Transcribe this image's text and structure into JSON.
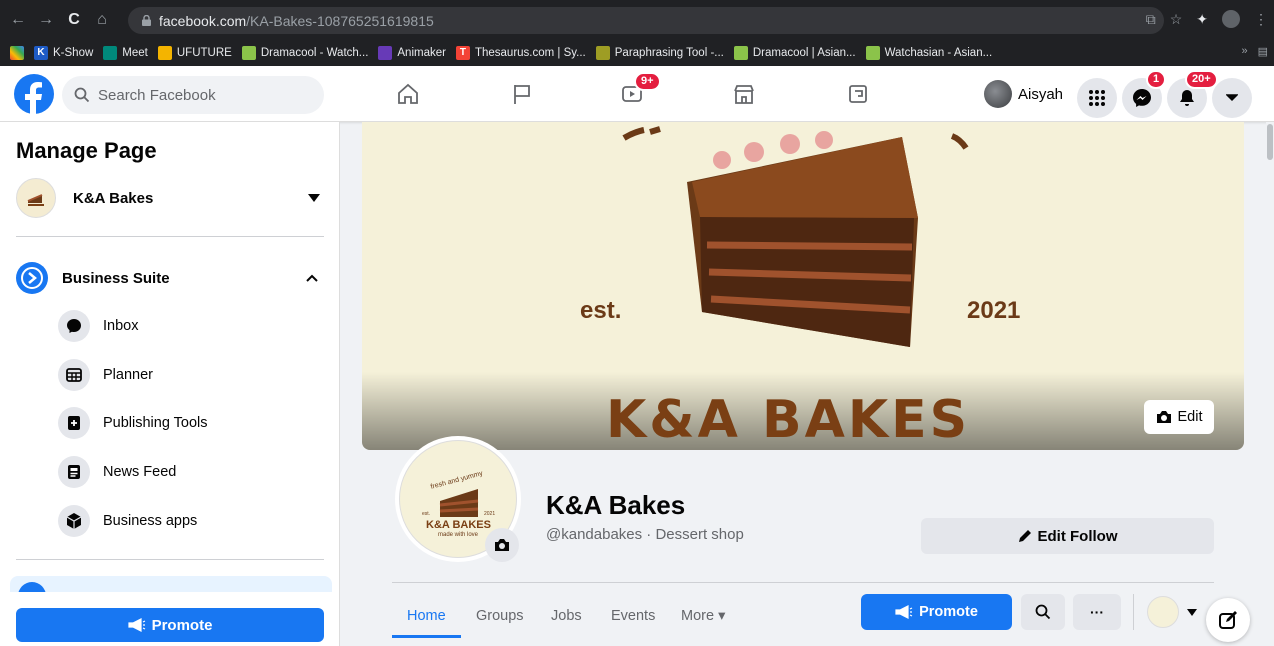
{
  "browser": {
    "url_domain": "facebook.com",
    "url_path": "/KA-Bakes-108765251619815",
    "bookmarks": [
      {
        "label": "K-Show",
        "icon": "k-show-icon",
        "color": "#3b5998"
      },
      {
        "label": "Meet",
        "icon": "meet-icon",
        "color": "#00897b"
      },
      {
        "label": "UFUTURE",
        "icon": "ufuture-icon",
        "color": "#f4b400"
      },
      {
        "label": "Dramacool - Watch...",
        "icon": "dramacool-icon",
        "color": "#8bc34a"
      },
      {
        "label": "Animaker",
        "icon": "animaker-icon",
        "color": "#673ab7"
      },
      {
        "label": "Thesaurus.com | Sy...",
        "icon": "thesaurus-icon",
        "color": "#f44336"
      },
      {
        "label": "Paraphrasing Tool -...",
        "icon": "paraphrasing-icon",
        "color": "#9e9d24"
      },
      {
        "label": "Dramacool | Asian...",
        "icon": "dramacool-icon",
        "color": "#8bc34a"
      },
      {
        "label": "Watchasian - Asian...",
        "icon": "watchasian-icon",
        "color": "#8bc34a"
      }
    ],
    "bookmarks_more": "»"
  },
  "topbar": {
    "search_placeholder": "Search Facebook",
    "watch_badge": "9+",
    "profile_name": "Aisyah",
    "messenger_badge": "1",
    "notifications_badge": "20+",
    "brand_color": "#1877f2"
  },
  "sidebar": {
    "title": "Manage Page",
    "page_name": "K&A Bakes",
    "business_suite_label": "Business Suite",
    "items": [
      {
        "label": "Inbox",
        "icon": "inbox-icon"
      },
      {
        "label": "Planner",
        "icon": "planner-icon"
      },
      {
        "label": "Publishing Tools",
        "icon": "publishing-tools-icon"
      },
      {
        "label": "News Feed",
        "icon": "news-feed-icon"
      },
      {
        "label": "Business apps",
        "icon": "business-apps-icon"
      }
    ],
    "promote_label": "Promote"
  },
  "cover": {
    "est_text": "est.",
    "year_text": "2021",
    "brand_text": "K&A BAKES",
    "edit_label": "Edit"
  },
  "profile": {
    "name": "K&A Bakes",
    "handle": "@kandabakes · Dessert shop",
    "edit_follow_label": "Edit Follow",
    "logo_tagline": "fresh and yummy",
    "logo_est": "est.",
    "logo_year": "2021",
    "logo_brand": "K&A BAKES",
    "logo_sub": "made with love"
  },
  "page_tabs": {
    "home": "Home",
    "groups": "Groups",
    "jobs": "Jobs",
    "events": "Events",
    "more": "More ▾",
    "promote_label": "Promote",
    "more_dots": "···"
  }
}
